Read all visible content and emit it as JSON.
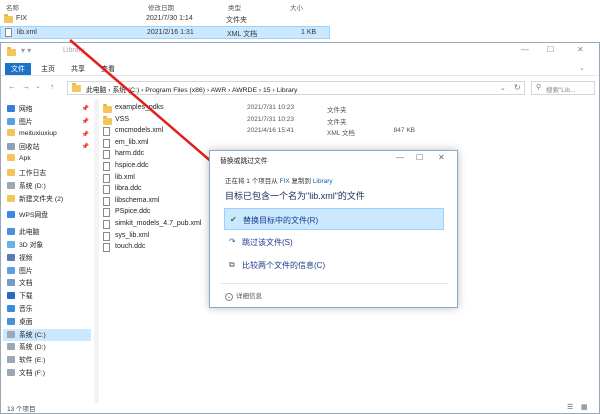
{
  "top_list": {
    "headers": [
      "名称",
      "修改日期",
      "类型",
      "大小"
    ],
    "rows": [
      {
        "name": "FIX",
        "date": "2021/7/30 1:14",
        "type": "文件夹",
        "size": ""
      },
      {
        "name": "lib.xml",
        "date": "2021/2/16 1:31",
        "type": "XML 文档",
        "size": "1 KB"
      }
    ]
  },
  "window": {
    "title": "Library",
    "ribbon_tabs": [
      "文件",
      "主页",
      "共享",
      "查看"
    ],
    "address": [
      "此电脑",
      "系统 (C:)",
      "Program Files (x86)",
      "AWR",
      "AWRDE",
      "15",
      "Library"
    ],
    "search_placeholder": "搜索\"Lib...",
    "status": "13 个项目"
  },
  "sidebar": [
    {
      "label": "网络",
      "pinned": true,
      "color": "#3a7bd5"
    },
    {
      "label": "图片",
      "pinned": true,
      "color": "#5aa0e6"
    },
    {
      "label": "meituxiuxiup",
      "pinned": true,
      "color": "#f4c55c"
    },
    {
      "label": "回收站",
      "pinned": true,
      "color": "#8aa0b8"
    },
    {
      "label": "Apk",
      "pinned": false,
      "color": "#f4c55c"
    },
    {
      "label": "工作日志",
      "pinned": false,
      "color": "#f4c55c"
    },
    {
      "label": "系统 (D:)",
      "pinned": false,
      "color": "#9aa8b8"
    },
    {
      "label": "新建文件夹 (2)",
      "pinned": false,
      "color": "#f4c55c"
    },
    {
      "label": "WPS网盘",
      "pinned": false,
      "color": "#3a8be0"
    },
    {
      "label": "此电脑",
      "pinned": false,
      "color": "#4a90d9"
    },
    {
      "label": "3D 对象",
      "pinned": false,
      "color": "#6ab0e8"
    },
    {
      "label": "视频",
      "pinned": false,
      "color": "#5a7ab8"
    },
    {
      "label": "图片",
      "pinned": false,
      "color": "#5aa0e6"
    },
    {
      "label": "文档",
      "pinned": false,
      "color": "#7a9ac8"
    },
    {
      "label": "下载",
      "pinned": false,
      "color": "#2a6ac0"
    },
    {
      "label": "音乐",
      "pinned": false,
      "color": "#3a8be0"
    },
    {
      "label": "桌面",
      "pinned": false,
      "color": "#4a90d9"
    },
    {
      "label": "系统 (C:)",
      "pinned": false,
      "color": "#9aa8b8",
      "selected": true
    },
    {
      "label": "系统 (D:)",
      "pinned": false,
      "color": "#9aa8b8"
    },
    {
      "label": "软件 (E:)",
      "pinned": false,
      "color": "#9aa8b8"
    },
    {
      "label": "文档 (F:)",
      "pinned": false,
      "color": "#9aa8b8"
    }
  ],
  "files": [
    {
      "name": "examples_pdks",
      "date": "2021/7/31 10:23",
      "type": "文件夹",
      "size": "",
      "folder": true
    },
    {
      "name": "VSS",
      "date": "2021/7/31 10:23",
      "type": "文件夹",
      "size": "",
      "folder": true
    },
    {
      "name": "cmcmodels.xml",
      "date": "2021/4/16 15:41",
      "type": "XML 文档",
      "size": "847 KB",
      "folder": false
    },
    {
      "name": "em_lib.xml",
      "date": "",
      "type": "",
      "size": "",
      "folder": false
    },
    {
      "name": "harm.ddc",
      "date": "",
      "type": "",
      "size": "",
      "folder": false
    },
    {
      "name": "hspice.ddc",
      "date": "",
      "type": "",
      "size": "",
      "folder": false
    },
    {
      "name": "lib.xml",
      "date": "",
      "type": "",
      "size": "",
      "folder": false
    },
    {
      "name": "libra.ddc",
      "date": "",
      "type": "",
      "size": "",
      "folder": false
    },
    {
      "name": "libschema.xml",
      "date": "",
      "type": "",
      "size": "",
      "folder": false
    },
    {
      "name": "PSpice.ddc",
      "date": "",
      "type": "",
      "size": "",
      "folder": false
    },
    {
      "name": "simkit_models_4.7_pub.xml",
      "date": "",
      "type": "",
      "size": "",
      "folder": false
    },
    {
      "name": "sys_lib.xml",
      "date": "",
      "type": "",
      "size": "",
      "folder": false
    },
    {
      "name": "touch.ddc",
      "date": "",
      "type": "",
      "size": "",
      "folder": false
    }
  ],
  "dialog": {
    "title": "替换或跳过文件",
    "info_prefix": "正在将 1 个项目从",
    "info_src": "FIX",
    "info_mid": "复制到",
    "info_dst": "Library",
    "heading": "目标已包含一个名为\"lib.xml\"的文件",
    "options": [
      {
        "icon": "check-icon",
        "label": "替换目标中的文件(R)"
      },
      {
        "icon": "skip-icon",
        "label": "跳过该文件(S)"
      },
      {
        "icon": "compare-icon",
        "label": "比较两个文件的信息(C)"
      }
    ],
    "details": "详细信息"
  },
  "colors": {
    "accent": "#1a73c6",
    "selection": "#cce8ff",
    "arrow": "#e02020"
  }
}
